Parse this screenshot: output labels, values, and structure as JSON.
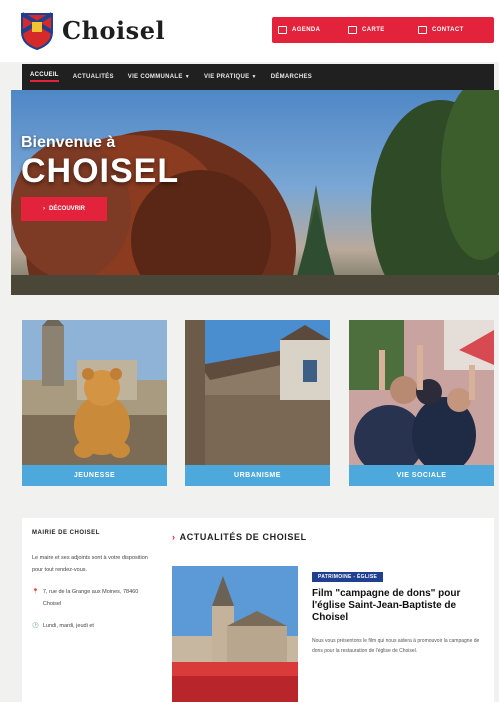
{
  "header": {
    "site_name": "Choisel",
    "actions": [
      {
        "label": "AGENDA",
        "icon": "calendar-icon"
      },
      {
        "label": "CARTE",
        "icon": "map-icon"
      },
      {
        "label": "CONTACT",
        "icon": "mail-icon"
      }
    ]
  },
  "nav": {
    "items": [
      {
        "label": "ACCUEIL",
        "active": true
      },
      {
        "label": "ACTUALITÉS"
      },
      {
        "label": "VIE COMMUNALE",
        "dropdown": true
      },
      {
        "label": "VIE PRATIQUE",
        "dropdown": true
      },
      {
        "label": "DÉMARCHES"
      }
    ]
  },
  "hero": {
    "subtitle": "Bienvenue à",
    "title": "CHOISEL",
    "button_label": "DÉCOUVRIR"
  },
  "cards": [
    {
      "label": "JEUNESSE"
    },
    {
      "label": "URBANISME"
    },
    {
      "label": "VIE SOCIALE"
    }
  ],
  "sidebar": {
    "title": "MAIRIE DE CHOISEL",
    "text": "Le maire et ses adjoints sont à votre disposition pour tout rendez-vous.",
    "address": "7, rue de la Grange aux Moines, 78460 Choisel",
    "hours": "Lundi, mardi, jeudi et"
  },
  "news": {
    "section_title": "ACTUALITÉS DE CHOISEL",
    "article": {
      "category": "PATRIMOINE - ÉGLISE",
      "headline": "Film \"campagne de dons\" pour l'église Saint-Jean-Baptiste de Choisel",
      "excerpt": "Nous vous présentons le film qui nous aidera à promouvoir la campagne de dons pour la restauration de l'église de Choisel."
    }
  },
  "colors": {
    "accent": "#e3233c",
    "nav_bg": "#202020",
    "card_label": "#4da9dc",
    "category": "#1f3f8f"
  }
}
